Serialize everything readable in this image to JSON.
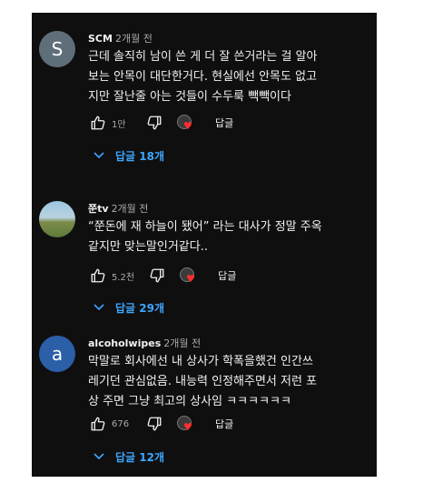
{
  "comments": [
    {
      "author": "SCM",
      "time": "2개월 전",
      "avatar_letter": "S",
      "avatar_color": "#5f6f7a",
      "text": "근데 솔직히 남이 쓴 게 더 잘 쓴거라는 걸 알아\n보는 안목이 대단한거다. 현실에선 안목도 없고\n지만 잘난줄 아는 것들이 수두룩 빽빽이다",
      "likes": "1만",
      "reply_label": "답글",
      "replies_label": "답글 18개"
    },
    {
      "author": "쭌tv",
      "time": "2개월 전",
      "avatar_letter": "",
      "avatar_color": "#8fb3c9",
      "text": "“쭌돈에 재 하늘이 됐어” 라는 대사가 정말 주옥\n같지만 맞는말인거같다..",
      "likes": "5.2천",
      "reply_label": "답글",
      "replies_label": "답글 29개"
    },
    {
      "author": "alcoholwipes",
      "time": "2개월 전",
      "avatar_letter": "a",
      "avatar_color": "#2b5fa8",
      "text": "막말로 회사에선 내 상사가 학폭을했건 인간쓰\n레기던 관심없음. 내능력 인정해주면서 저런 포\n상 주면 그냥 최고의 상사임 ㅋㅋㅋㅋㅋㅋ",
      "likes": "676",
      "reply_label": "답글",
      "replies_label": "답글 12개"
    }
  ],
  "colors": {
    "background": "#0f0f0f",
    "text_primary": "#f1f1f1",
    "text_secondary": "#aaaaaa",
    "link": "#3ea6ff",
    "heart": "#ff2d2d"
  },
  "icons": {
    "like": "thumbs-up-icon",
    "dislike": "thumbs-down-icon",
    "creator_heart": "heart-icon",
    "expand": "chevron-down-icon"
  }
}
